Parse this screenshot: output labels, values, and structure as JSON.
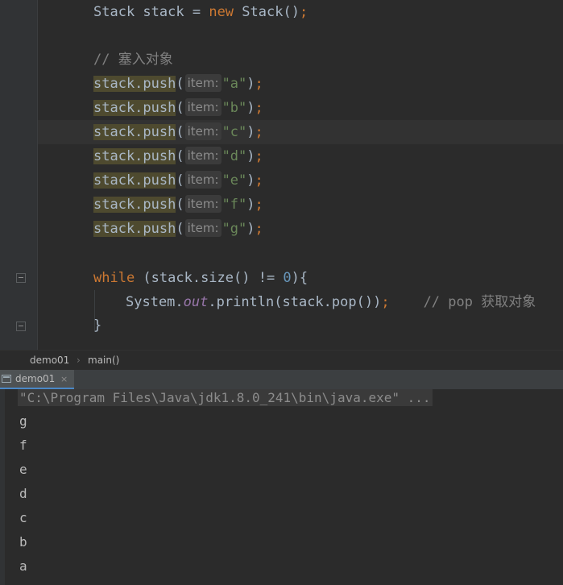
{
  "editor": {
    "lines": {
      "stack_decl": {
        "type": "Stack",
        "var": " stack ",
        "eq": "= ",
        "new": "new",
        "ctor": " Stack",
        "parens": "()",
        "semi": ";"
      },
      "comment_push": "// 塞入对象",
      "push_prefix": "stack.push",
      "hint_label": "item:",
      "push_values": [
        "\"a\"",
        "\"b\"",
        "\"c\"",
        "\"d\"",
        "\"e\"",
        "\"f\"",
        "\"g\""
      ],
      "while_kw": "while",
      "while_cond_a": " (stack.size() != ",
      "while_num": "0",
      "while_cond_b": "){",
      "print_sys": "System.",
      "print_out": "out",
      "print_rest": ".println(stack.pop())",
      "print_semi": ";",
      "print_comment": "// pop 获取对象",
      "close_brace": "}"
    }
  },
  "breadcrumb": {
    "items": [
      "demo01",
      "main()"
    ],
    "separator": "›"
  },
  "run_panel": {
    "tab_label": "demo01",
    "close_glyph": "×"
  },
  "console": {
    "command": "\"C:\\Program Files\\Java\\jdk1.8.0_241\\bin\\java.exe\" ...",
    "output": [
      "g",
      "f",
      "e",
      "d",
      "c",
      "b",
      "a"
    ]
  }
}
